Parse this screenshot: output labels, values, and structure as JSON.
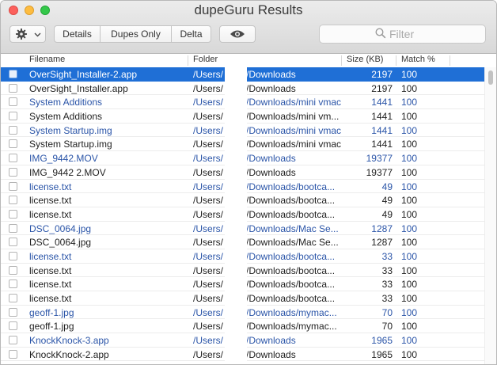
{
  "window": {
    "title": "dupeGuru Results"
  },
  "toolbar": {
    "gear_icon": "gear-icon",
    "gear_chevron": "chevron-down-icon",
    "details_label": "Details",
    "dupes_only_label": "Dupes Only",
    "delta_label": "Delta",
    "eye_icon": "eye-icon",
    "filter_placeholder": "Filter",
    "filter_value": ""
  },
  "columns": {
    "filename": "Filename",
    "folder": "Folder",
    "size": "Size (KB)",
    "match": "Match %"
  },
  "colors": {
    "selection": "#1f6fd6",
    "reference_text": "#2b55a8"
  },
  "rows": [
    {
      "name": "OverSight_Installer-2.app",
      "user": "/Users/",
      "path": "/Downloads",
      "size": "2197",
      "match": "100",
      "ref": true,
      "selected": true
    },
    {
      "name": "OverSight_Installer.app",
      "user": "/Users/",
      "path": "/Downloads",
      "size": "2197",
      "match": "100",
      "ref": false
    },
    {
      "name": "System Additions",
      "user": "/Users/",
      "path": "/Downloads/mini vmac",
      "size": "1441",
      "match": "100",
      "ref": true
    },
    {
      "name": "System Additions",
      "user": "/Users/",
      "path": "/Downloads/mini vm...",
      "size": "1441",
      "match": "100",
      "ref": false
    },
    {
      "name": "System Startup.img",
      "user": "/Users/",
      "path": "/Downloads/mini vmac",
      "size": "1441",
      "match": "100",
      "ref": true
    },
    {
      "name": "System Startup.img",
      "user": "/Users/",
      "path": "/Downloads/mini vmac",
      "size": "1441",
      "match": "100",
      "ref": false
    },
    {
      "name": "IMG_9442.MOV",
      "user": "/Users/",
      "path": "/Downloads",
      "size": "19377",
      "match": "100",
      "ref": true
    },
    {
      "name": "IMG_9442 2.MOV",
      "user": "/Users/",
      "path": "/Downloads",
      "size": "19377",
      "match": "100",
      "ref": false
    },
    {
      "name": "license.txt",
      "user": "/Users/",
      "path": "/Downloads/bootca...",
      "size": "49",
      "match": "100",
      "ref": true
    },
    {
      "name": "license.txt",
      "user": "/Users/",
      "path": "/Downloads/bootca...",
      "size": "49",
      "match": "100",
      "ref": false
    },
    {
      "name": "license.txt",
      "user": "/Users/",
      "path": "/Downloads/bootca...",
      "size": "49",
      "match": "100",
      "ref": false
    },
    {
      "name": "DSC_0064.jpg",
      "user": "/Users/",
      "path": "/Downloads/Mac Se...",
      "size": "1287",
      "match": "100",
      "ref": true
    },
    {
      "name": "DSC_0064.jpg",
      "user": "/Users/",
      "path": "/Downloads/Mac Se...",
      "size": "1287",
      "match": "100",
      "ref": false
    },
    {
      "name": "license.txt",
      "user": "/Users/",
      "path": "/Downloads/bootca...",
      "size": "33",
      "match": "100",
      "ref": true
    },
    {
      "name": "license.txt",
      "user": "/Users/",
      "path": "/Downloads/bootca...",
      "size": "33",
      "match": "100",
      "ref": false
    },
    {
      "name": "license.txt",
      "user": "/Users/",
      "path": "/Downloads/bootca...",
      "size": "33",
      "match": "100",
      "ref": false
    },
    {
      "name": "license.txt",
      "user": "/Users/",
      "path": "/Downloads/bootca...",
      "size": "33",
      "match": "100",
      "ref": false
    },
    {
      "name": "geoff-1.jpg",
      "user": "/Users/",
      "path": "/Downloads/mymac...",
      "size": "70",
      "match": "100",
      "ref": true
    },
    {
      "name": "geoff-1.jpg",
      "user": "/Users/",
      "path": "/Downloads/mymac...",
      "size": "70",
      "match": "100",
      "ref": false
    },
    {
      "name": "KnockKnock-3.app",
      "user": "/Users/",
      "path": "/Downloads",
      "size": "1965",
      "match": "100",
      "ref": true
    },
    {
      "name": "KnockKnock-2.app",
      "user": "/Users/",
      "path": "/Downloads",
      "size": "1965",
      "match": "100",
      "ref": false
    }
  ]
}
